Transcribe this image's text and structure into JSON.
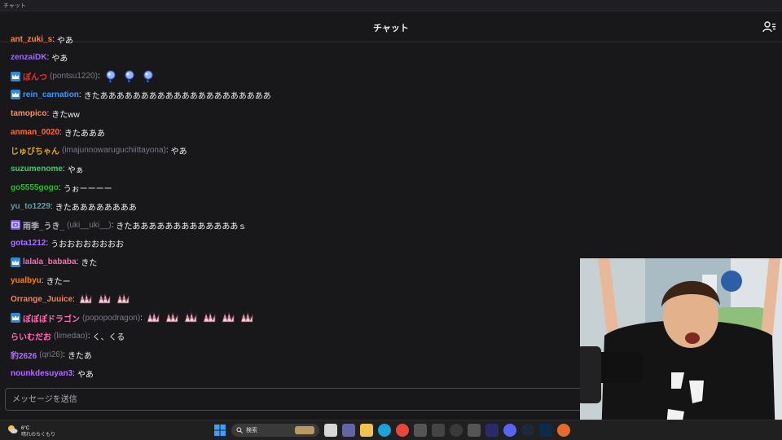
{
  "window": {
    "title": "チャット"
  },
  "header": {
    "title": "チャット",
    "icon": "users-icon"
  },
  "messages": [
    {
      "user": "ant_zuki_s",
      "login": "",
      "text": "やあ",
      "color": "#ff7f50",
      "badge": "",
      "emotes": 0
    },
    {
      "user": "zenzaiDK",
      "login": "",
      "text": "やあ",
      "color": "#9e6bff",
      "badge": "",
      "emotes": 0
    },
    {
      "user": "ぽんつ",
      "login": "(pontsu1220)",
      "text": "",
      "color": "#ff2a2a",
      "badge": "crown",
      "emotes": 3
    },
    {
      "user": "rein_carnation",
      "login": "",
      "text": "きたあああああああああああああああああああああ",
      "color": "#3a9bff",
      "badge": "crown",
      "emotes": 0
    },
    {
      "user": "tamopico",
      "login": "",
      "text": "きたww",
      "color": "#ff8f5a",
      "badge": "",
      "emotes": 0
    },
    {
      "user": "anman_0020",
      "login": "",
      "text": "きたあああ",
      "color": "#ff6a3d",
      "badge": "",
      "emotes": 0
    },
    {
      "user": "じゅびちゃん",
      "login": "(imajunnowaruguchiittayona)",
      "text": "やあ",
      "color": "#daa520",
      "badge": "",
      "emotes": 0
    },
    {
      "user": "suzumenome",
      "login": "",
      "text": "やぁ",
      "color": "#2ad86a",
      "badge": "",
      "emotes": 0
    },
    {
      "user": "go5555gogo",
      "login": "",
      "text": "うぉーーーー",
      "color": "#2eb82e",
      "badge": "",
      "emotes": 0
    },
    {
      "user": "yu_to1229",
      "login": "",
      "text": "きたああああああああ",
      "color": "#5f9ea0",
      "badge": "",
      "emotes": 0
    },
    {
      "user": "雨季_うき_",
      "login": "(uki__uki__)",
      "text": "きたあああああああああああああｓ",
      "color": "#adadb8",
      "badge": "purple",
      "emotes": 0
    },
    {
      "user": "gota1212",
      "login": "",
      "text": "うおおおおおおおお",
      "color": "#a970ff",
      "badge": "",
      "emotes": 0
    },
    {
      "user": "lalala_bababa",
      "login": "",
      "text": "きた",
      "color": "#ff69b4",
      "badge": "crown",
      "emotes": 0
    },
    {
      "user": "yualbyu",
      "login": "",
      "text": "きたー",
      "color": "#ff7f00",
      "badge": "",
      "emotes": 0
    },
    {
      "user": "Orrange_Juuice",
      "login": "",
      "text": "",
      "color": "#ff7f50",
      "badge": "",
      "emotes": 3
    },
    {
      "user": "ぽぽぽドラゴン",
      "login": "(popopodragon)",
      "text": "",
      "color": "#ff69b4",
      "badge": "crown",
      "emotes": 6
    },
    {
      "user": "らいむだお",
      "login": "(limedao)",
      "text": "く、くる",
      "color": "#ff69b4",
      "badge": "",
      "emotes": 0
    },
    {
      "user": "豹2626",
      "login": "(qri26)",
      "text": "きたあ",
      "color": "#b36bff",
      "badge": "",
      "emotes": 0
    },
    {
      "user": "nounkdesuyan3",
      "login": "",
      "text": "やあ",
      "color": "#b36bff",
      "badge": "",
      "emotes": 0
    }
  ],
  "input": {
    "placeholder": "メッセージを送信"
  },
  "taskbar": {
    "weather_temp": "6°C",
    "weather_condition": "晴れのちくもり",
    "search_placeholder": "検索",
    "apps": [
      "windows-start-icon",
      "search",
      "file-explorer-icon",
      "teams-icon",
      "folder-icon",
      "edge-icon",
      "chrome-icon",
      "app-icon",
      "4k-app-icon",
      "obs-icon",
      "app-icon",
      "premiere-icon",
      "discord-icon",
      "steam-icon",
      "photoshop-icon",
      "firefox-icon"
    ]
  },
  "colors": {
    "background": "#18181b",
    "border": "#2f2f35",
    "accent": "#9147ff"
  }
}
